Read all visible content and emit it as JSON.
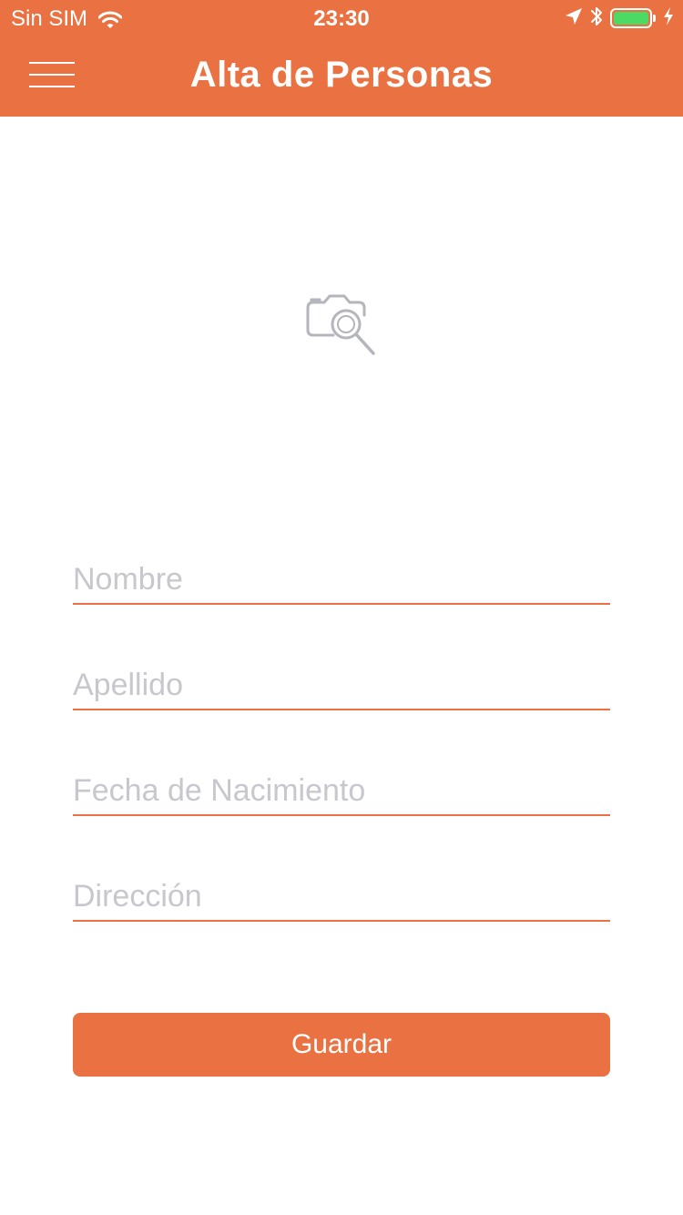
{
  "status_bar": {
    "carrier": "Sin SIM",
    "time": "23:30",
    "battery_level": 1.0,
    "icons": [
      "wifi-icon",
      "location-arrow-icon",
      "bluetooth-icon",
      "battery-icon",
      "charging-bolt-icon"
    ]
  },
  "header": {
    "title": "Alta de Personas",
    "menu_icon": "hamburger-menu-icon"
  },
  "photo": {
    "icon": "camera-search-icon"
  },
  "form": {
    "nombre_placeholder": "Nombre",
    "apellido_placeholder": "Apellido",
    "fecha_placeholder": "Fecha de Nacimiento",
    "direccion_placeholder": "Dirección",
    "nombre_value": "",
    "apellido_value": "",
    "fecha_value": "",
    "direccion_value": ""
  },
  "actions": {
    "save_label": "Guardar"
  },
  "colors": {
    "accent": "#EA7141",
    "placeholder": "#C7C7CD",
    "battery_fill": "#4CD964",
    "icon_gray": "#B5B5BD"
  }
}
